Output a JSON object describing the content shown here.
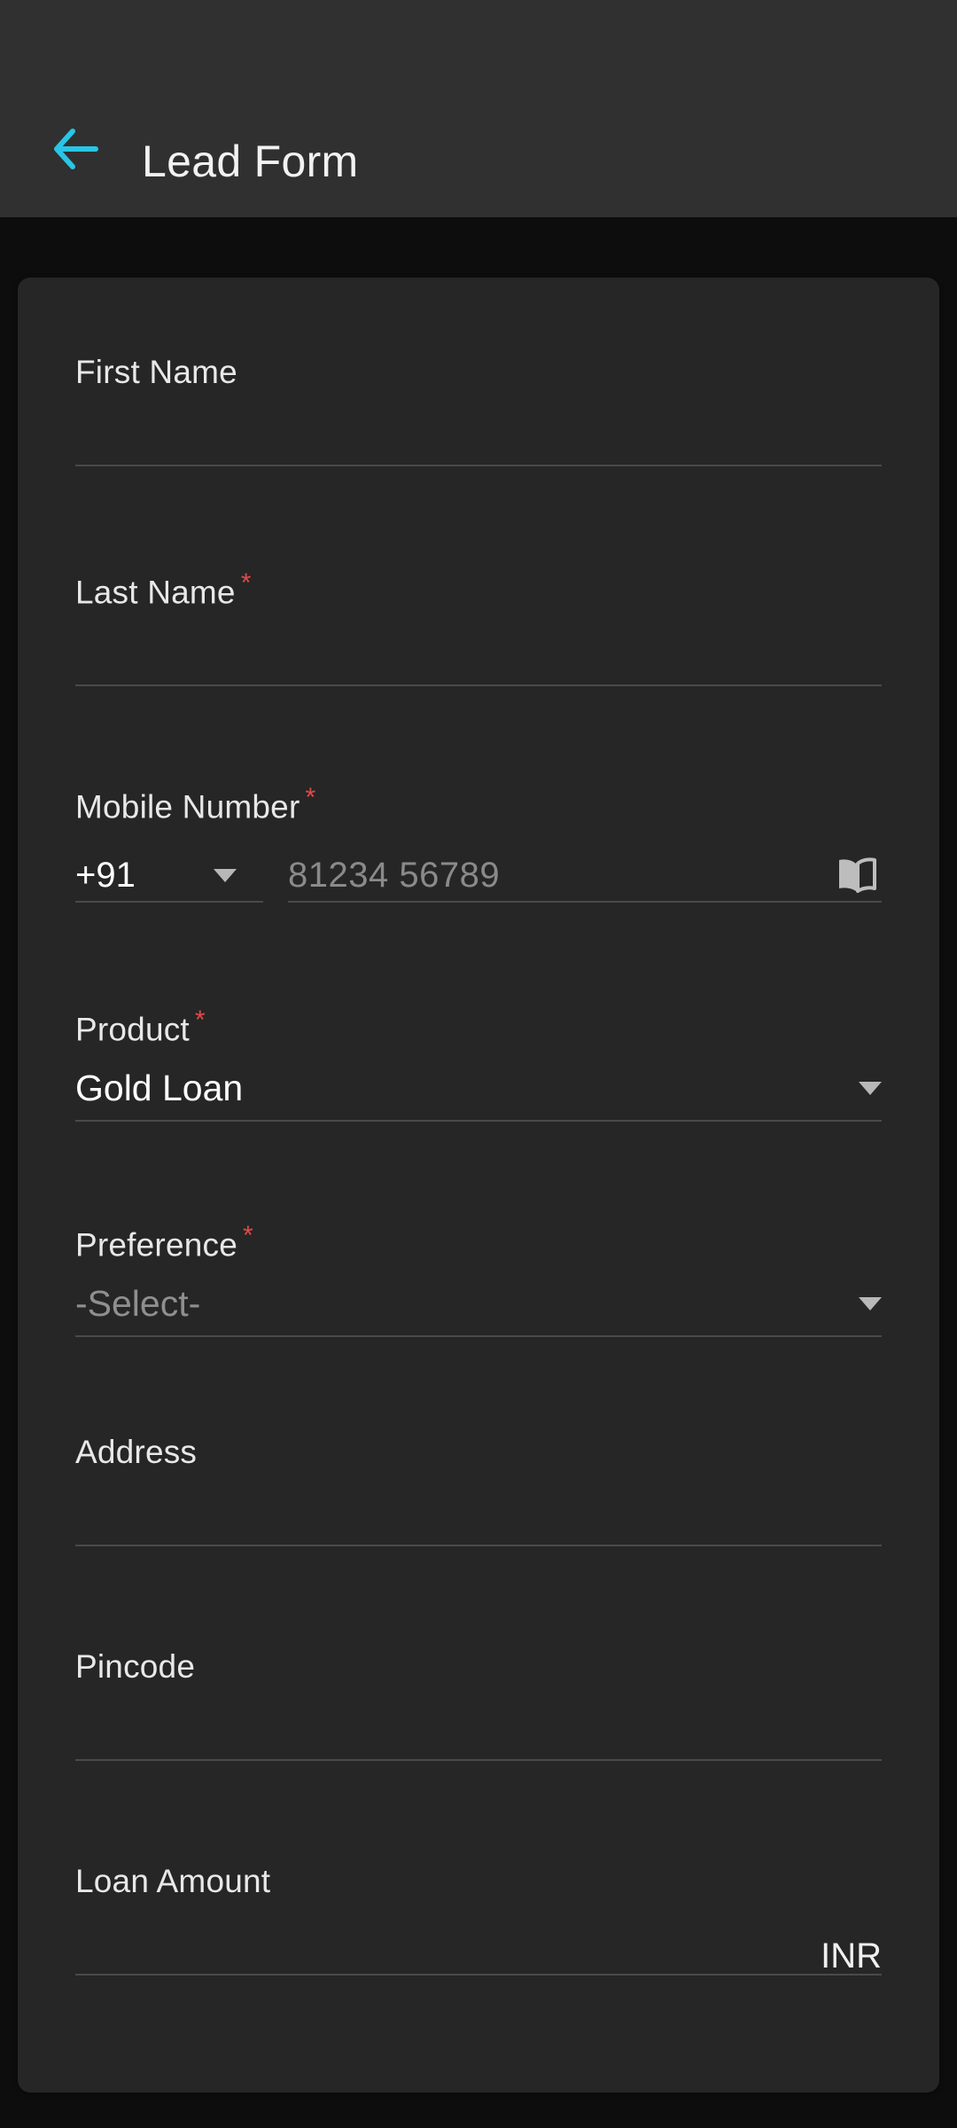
{
  "header": {
    "title": "Lead Form",
    "back_icon": "arrow-left-icon",
    "accent_color": "#29c5e6",
    "background_color": "#303030"
  },
  "theme": {
    "page_background": "#0d0d0d",
    "card_background": "#262626",
    "label_color": "#e8e8e8",
    "placeholder_color": "#8a8a8a",
    "underline_color": "#4a4a4a",
    "required_color": "#e04a4a"
  },
  "form": {
    "fields": [
      {
        "key": "first_name",
        "label": "First Name",
        "required": false,
        "value": "",
        "placeholder": ""
      },
      {
        "key": "last_name",
        "label": "Last Name",
        "required": true,
        "required_marker": "*",
        "value": "",
        "placeholder": ""
      },
      {
        "key": "mobile_number",
        "label": "Mobile Number",
        "required": true,
        "required_marker": "*",
        "country_code": "+91",
        "value": "",
        "placeholder": "81234 56789",
        "contacts_icon": "address-book-icon"
      },
      {
        "key": "product",
        "label": "Product",
        "required": true,
        "required_marker": "*",
        "value": "Gold Loan",
        "is_placeholder": false
      },
      {
        "key": "preference",
        "label": "Preference",
        "required": true,
        "required_marker": "*",
        "value": "-Select-",
        "is_placeholder": true
      },
      {
        "key": "address",
        "label": "Address",
        "required": false,
        "value": "",
        "placeholder": ""
      },
      {
        "key": "pincode",
        "label": "Pincode",
        "required": false,
        "value": "",
        "placeholder": ""
      },
      {
        "key": "loan_amount",
        "label": "Loan Amount",
        "required": false,
        "value": "",
        "currency_suffix": "INR"
      }
    ]
  }
}
